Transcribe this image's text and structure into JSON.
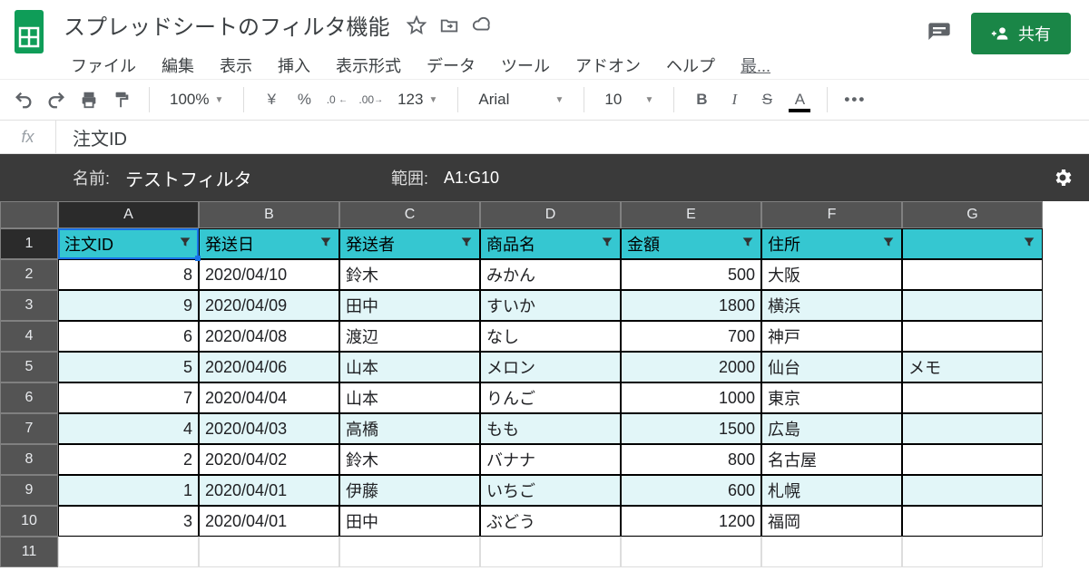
{
  "doc": {
    "title": "スプレッドシートのフィルタ機能",
    "share_label": "共有"
  },
  "menu": {
    "items": [
      "ファイル",
      "編集",
      "表示",
      "挿入",
      "表示形式",
      "データ",
      "ツール",
      "アドオン",
      "ヘルプ"
    ],
    "last": "最..."
  },
  "toolbar": {
    "zoom": "100%",
    "currency": "¥",
    "percent": "%",
    "dec_less": ".0",
    "dec_more": ".00",
    "format123": "123",
    "font": "Arial",
    "font_size": "10",
    "bold": "B",
    "italic": "I",
    "strike": "S",
    "text_color": "A",
    "more": "•••"
  },
  "formula": {
    "fx": "fx",
    "value": "注文ID"
  },
  "filter": {
    "name_label": "名前:",
    "name_value": "テストフィルタ",
    "range_label": "範囲:",
    "range_value": "A1:G10"
  },
  "columns": [
    "A",
    "B",
    "C",
    "D",
    "E",
    "F",
    "G"
  ],
  "headers": [
    "注文ID",
    "発送日",
    "発送者",
    "商品名",
    "金額",
    "住所",
    ""
  ],
  "rows": [
    {
      "n": "2",
      "alt": false,
      "c": [
        "8",
        "2020/04/10",
        "鈴木",
        "みかん",
        "500",
        "大阪",
        ""
      ]
    },
    {
      "n": "3",
      "alt": true,
      "c": [
        "9",
        "2020/04/09",
        "田中",
        "すいか",
        "1800",
        "横浜",
        ""
      ]
    },
    {
      "n": "4",
      "alt": false,
      "c": [
        "6",
        "2020/04/08",
        "渡辺",
        "なし",
        "700",
        "神戸",
        ""
      ]
    },
    {
      "n": "5",
      "alt": true,
      "c": [
        "5",
        "2020/04/06",
        "山本",
        "メロン",
        "2000",
        "仙台",
        "メモ"
      ]
    },
    {
      "n": "6",
      "alt": false,
      "c": [
        "7",
        "2020/04/04",
        "山本",
        "りんご",
        "1000",
        "東京",
        ""
      ]
    },
    {
      "n": "7",
      "alt": true,
      "c": [
        "4",
        "2020/04/03",
        "高橋",
        "もも",
        "1500",
        "広島",
        ""
      ]
    },
    {
      "n": "8",
      "alt": false,
      "c": [
        "2",
        "2020/04/02",
        "鈴木",
        "バナナ",
        "800",
        "名古屋",
        ""
      ]
    },
    {
      "n": "9",
      "alt": true,
      "c": [
        "1",
        "2020/04/01",
        "伊藤",
        "いちご",
        "600",
        "札幌",
        ""
      ]
    },
    {
      "n": "10",
      "alt": false,
      "c": [
        "3",
        "2020/04/01",
        "田中",
        "ぶどう",
        "1200",
        "福岡",
        ""
      ]
    }
  ],
  "empty_row": "11"
}
